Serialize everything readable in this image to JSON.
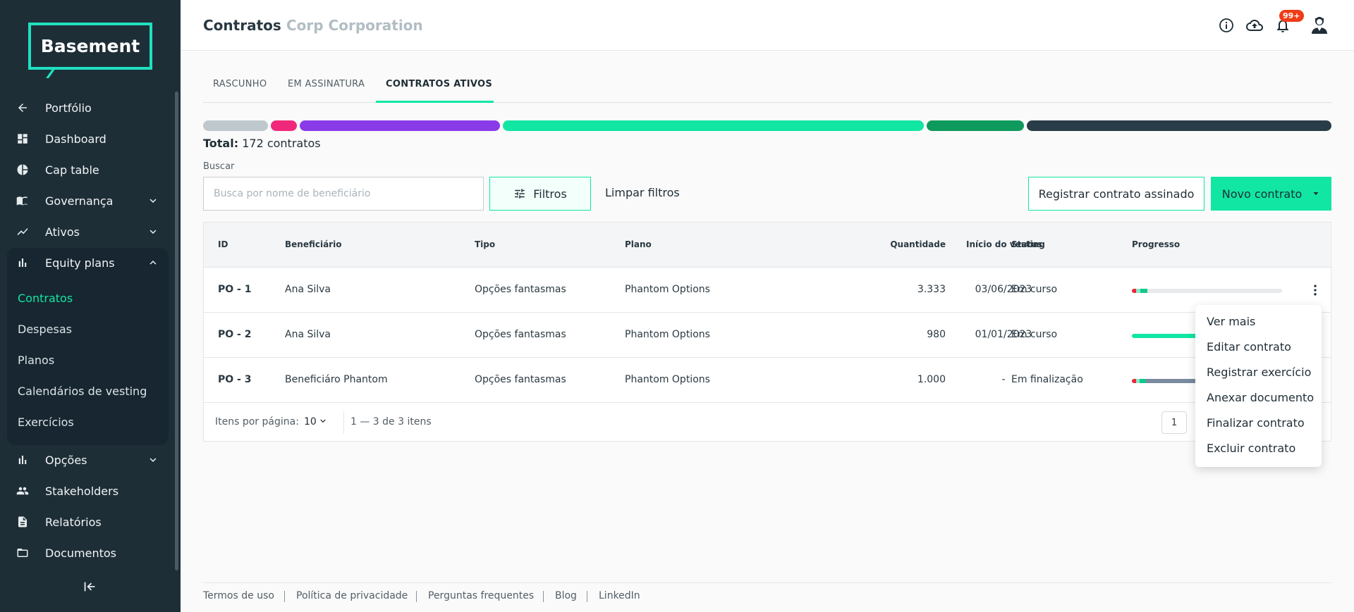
{
  "app": {
    "logo_text": "Basement"
  },
  "sidebar": {
    "items": [
      {
        "label": "Portfólio",
        "icon": "arrow-left-icon"
      },
      {
        "label": "Dashboard",
        "icon": "dashboard-icon"
      },
      {
        "label": "Cap table",
        "icon": "pie-chart-icon"
      },
      {
        "label": "Governança",
        "icon": "book-icon"
      },
      {
        "label": "Ativos",
        "icon": "trend-icon"
      },
      {
        "label": "Equity plans",
        "icon": "bar-chart-icon"
      },
      {
        "label": "Opções",
        "icon": "bar-chart-icon"
      },
      {
        "label": "Stakeholders",
        "icon": "people-icon"
      },
      {
        "label": "Relatórios",
        "icon": "document-icon"
      },
      {
        "label": "Documentos",
        "icon": "folder-icon"
      }
    ],
    "equity_sub": [
      {
        "label": "Contratos",
        "active": true
      },
      {
        "label": "Despesas"
      },
      {
        "label": "Planos"
      },
      {
        "label": "Calendários de vesting"
      },
      {
        "label": "Exercícios"
      }
    ]
  },
  "header": {
    "title": "Contratos",
    "company": "Corp Corporation",
    "notification_badge": "99+"
  },
  "tabs": [
    {
      "label": "RASCUNHO"
    },
    {
      "label": "EM ASSINATURA"
    },
    {
      "label": "CONTRATOS ATIVOS",
      "active": true
    }
  ],
  "status_segments": [
    {
      "color": "#bfc8cd"
    },
    {
      "color": "#f0287b"
    },
    {
      "color": "#8a3be8"
    },
    {
      "color": "#11e6a3"
    },
    {
      "color": "#0e9a5c"
    },
    {
      "color": "#293d48"
    }
  ],
  "summary": {
    "total_label": "Total:",
    "total_value": "172 contratos"
  },
  "search": {
    "label": "Buscar",
    "placeholder": "Busca por nome de beneficiário"
  },
  "toolbar": {
    "filter_label": "Filtros",
    "clear_label": "Limpar filtros",
    "register_label": "Registrar contrato assinado",
    "new_label": "Novo contrato"
  },
  "table": {
    "columns": [
      "ID",
      "Beneficiário",
      "Tipo",
      "Plano",
      "Quantidade",
      "Início do vesting",
      "Status",
      "Progresso"
    ],
    "rows": [
      {
        "id": "PO - 1",
        "beneficiary": "Ana Silva",
        "type": "Opções fantasmas",
        "plan": "Phantom Options",
        "quantity": "3.333",
        "vesting_start": "03/06/2023",
        "status": "Em curso"
      },
      {
        "id": "PO - 2",
        "beneficiary": "Ana Silva",
        "type": "Opções fantasmas",
        "plan": "Phantom Options",
        "quantity": "980",
        "vesting_start": "01/01/2023",
        "status": "Em curso"
      },
      {
        "id": "PO - 3",
        "beneficiary": "Beneficiáro Phantom",
        "type": "Opções fantasmas",
        "plan": "Phantom Options",
        "quantity": "1.000",
        "vesting_start": "-",
        "status": "Em finalização"
      }
    ],
    "footer": {
      "per_page_label": "Itens por página:",
      "per_page_value": "10",
      "range": "1 — 3 de 3 itens",
      "page": "1"
    }
  },
  "row_menu": {
    "items": [
      "Ver mais",
      "Editar contrato",
      "Registrar exercício",
      "Anexar documento",
      "Finalizar contrato",
      "Excluir contrato"
    ]
  },
  "footer_links": [
    "Termos de uso",
    "Política de privacidade",
    "Perguntas frequentes",
    "Blog",
    "LinkedIn"
  ]
}
